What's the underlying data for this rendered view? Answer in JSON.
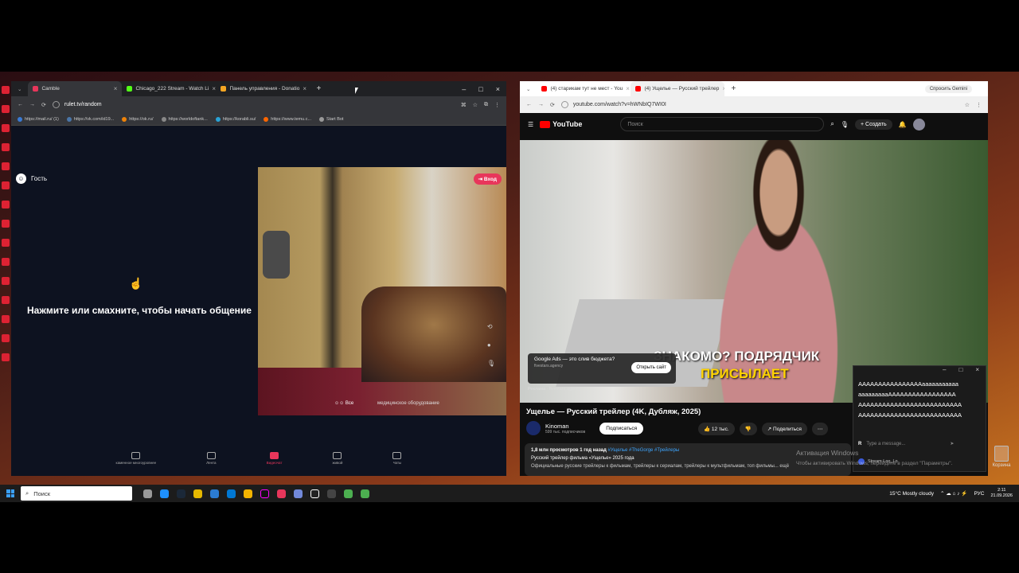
{
  "left_browser": {
    "tabs": [
      {
        "label": "Camble",
        "color": "#e8365b"
      },
      {
        "label": "Chicago_222 Stream - Watch Li",
        "color": "#53fc18"
      },
      {
        "label": "Панель управления - Donatio",
        "color": "#f5a623"
      }
    ],
    "url": "rulet.tv/random",
    "bookmarks": [
      "https://mail.ru/ (1)",
      "https://vk.com/id19...",
      "https://ok.ru/",
      "https://worldoftank...",
      "https://korabli.su/",
      "https://www.temu.c...",
      "Start Bot"
    ],
    "guest_label": "Гость",
    "prompt": "Нажмите или смахните, чтобы начать общение",
    "login_button": "Вход",
    "camera_filter": "Все",
    "camera_hint": "медицинское оборудование",
    "nav": [
      "каменное многоуровнее",
      "Лента",
      "Видеочат",
      "живой",
      "Чаты"
    ],
    "active_nav": 2
  },
  "right_browser": {
    "tabs": [
      {
        "label": "(4) старикам тут не мест - You",
        "color": "#ff0000"
      },
      {
        "label": "(4) Ущелье — Русский трейлер",
        "color": "#ff0000"
      }
    ],
    "gemini": "Спросить Gemini",
    "url": "youtube.com/watch?v=hWNbIQ7WI0I",
    "search_placeholder": "Поиск",
    "create": "Создать",
    "notif_count": "9+",
    "overlay_line1": "ЗНАКОМО? ПОДРЯДЧИК",
    "overlay_line2": "ПРИСЫЛАЕТ",
    "ad": {
      "title": "Google Ads — это слив бюджета?",
      "sub": "fivestars.agency",
      "button": "Открыть сайт",
      "label": "Реклама · fivestars.agency"
    },
    "video_title": "Ущелье — Русский трейлер (4K, Дубляж, 2025)",
    "channel": "Kinoman",
    "subscribers": "599 тыс. подписчиков",
    "subscribe": "Подписаться",
    "likes": "12 тыс.",
    "share": "Поделиться",
    "views_line": "1,8 млн просмотров  1 год назад",
    "tags": "#Ущелье #TheGorge #Трейлеры",
    "desc_line": "Русский трейлер фильма «Ущелье» 2025 года",
    "desc_more": "Официальные русские трейлеры к фильмам, трейлеры к сериалам, трейлеры к мультфильмам, топ фильмы... ещё"
  },
  "chat": {
    "messages": [
      "AAAAAAAAAAAAAAAAaaaaaaaaaaa",
      "aaaaaaaaaAAAAAAAAAAAAAAAAA",
      "AAAAAAAAAAAAAAAAAAAAAAAAAA",
      "AAAAAAAAAAAAAAAAAAAAAAAAAA"
    ],
    "input_placeholder": "Type a message...",
    "status": "Stream Loo_Lo"
  },
  "windows_activation": {
    "title": "Активация Windows",
    "sub": "Чтобы активировать Windows, перейдите в раздел \"Параметры\"."
  },
  "taskbar": {
    "search": "Поиск",
    "weather": "15°C  Mostly cloudy",
    "lang": "РУС",
    "time": "2:11",
    "date": "21.09.2026"
  },
  "recycle_bin": "Корзина"
}
